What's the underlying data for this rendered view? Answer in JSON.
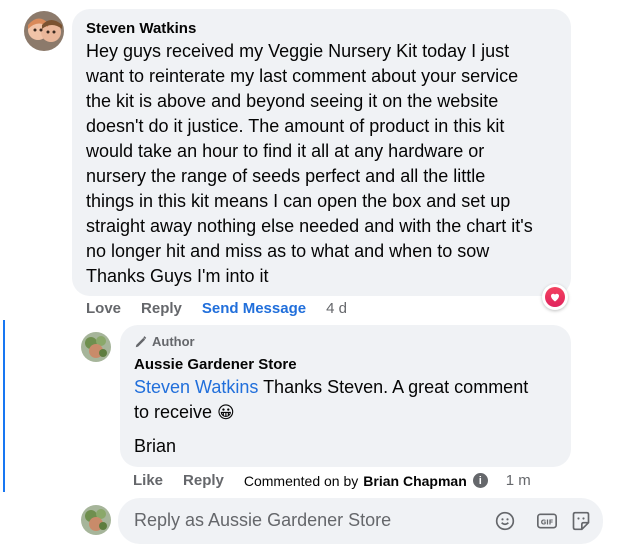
{
  "comment": {
    "author": "Steven Watkins",
    "text": "Hey guys received my Veggie Nursery Kit today I just\nwant to reinterate my last comment about your service\nthe kit is above and beyond seeing it on the website\ndoesn't do it justice. The amount of product in this kit\nwould take an hour to find it all at any hardware or\nnursery the range of seeds perfect and all the little\nthings in this kit means I can open the box and set up\nstraight away nothing else needed and with the chart it's\nno longer hit and miss as to what and when to sow\nThanks Guys I'm into it",
    "actions": {
      "love": "Love",
      "reply": "Reply",
      "send_message": "Send Message",
      "time": "4 d"
    },
    "reaction_icon": "heart-icon"
  },
  "reply": {
    "badge": "Author",
    "author": "Aussie Gardener Store",
    "mention": "Steven Watkins",
    "text_after_mention": " Thanks Steven. A great comment\nto receive ",
    "emoji": "😀",
    "signature": "Brian",
    "actions": {
      "like": "Like",
      "reply": "Reply",
      "commented_on_by": "Commented on by",
      "commenter": "Brian Chapman",
      "time": "1 m"
    }
  },
  "reply_box": {
    "placeholder": "Reply as Aussie Gardener Store",
    "icons": [
      "emoji-icon",
      "gif-icon",
      "sticker-icon"
    ]
  },
  "colors": {
    "link": "#216fdb",
    "bubble": "#f0f2f5",
    "thread_line": "#1877f2",
    "heart": "#f3425f"
  }
}
